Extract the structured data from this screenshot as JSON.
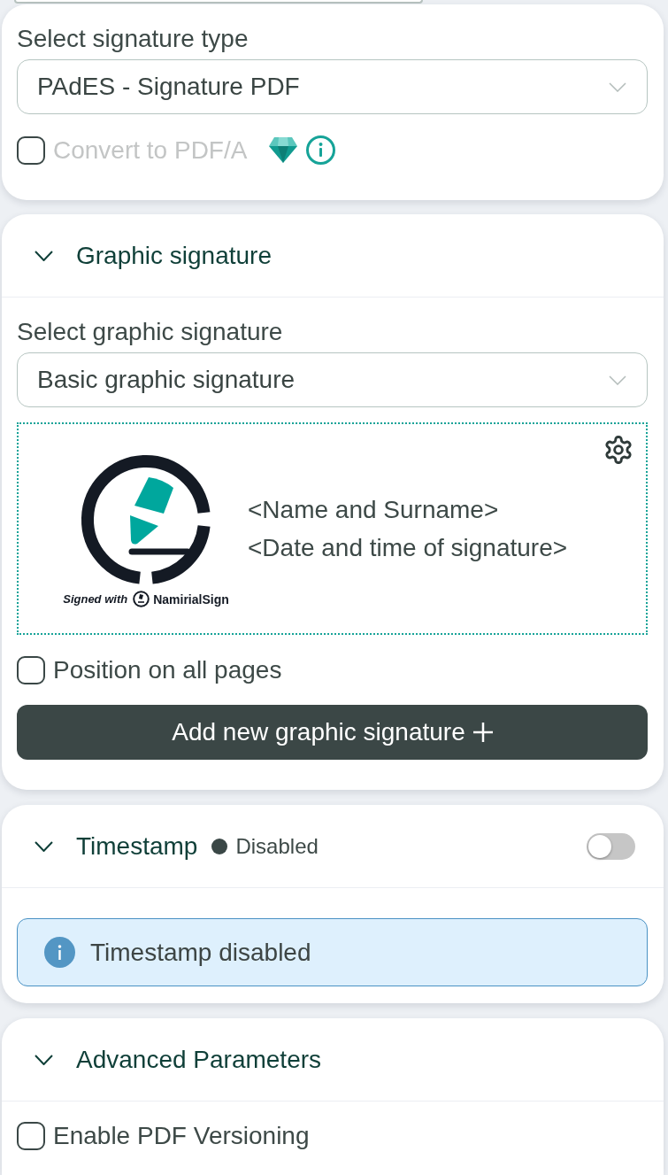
{
  "signature_type": {
    "label": "Select signature type",
    "value": "PAdES - Signature PDF"
  },
  "convert_pdfa": {
    "label": "Convert to PDF/A",
    "checked": false,
    "disabled": true
  },
  "sections": [
    {
      "kind": "graphic",
      "title": "Graphic signature",
      "expanded": true,
      "select": {
        "label": "Select graphic signature",
        "value": "Basic graphic signature"
      },
      "preview": {
        "caption": "Signed with",
        "brand": "NamirialSign",
        "lines": [
          "<Name and Surname>",
          "<Date and time of signature>"
        ]
      },
      "all_pages": {
        "label": "Position on all pages",
        "checked": false
      },
      "add_button": "Add new graphic signature"
    },
    {
      "kind": "timestamp",
      "title": "Timestamp",
      "expanded": true,
      "status": "Disabled",
      "on": false,
      "alert": "Timestamp disabled"
    },
    {
      "kind": "advanced",
      "title": "Advanced Parameters",
      "expanded": true,
      "options": [
        {
          "label": "Enable PDF Versioning",
          "checked": false
        }
      ]
    }
  ]
}
